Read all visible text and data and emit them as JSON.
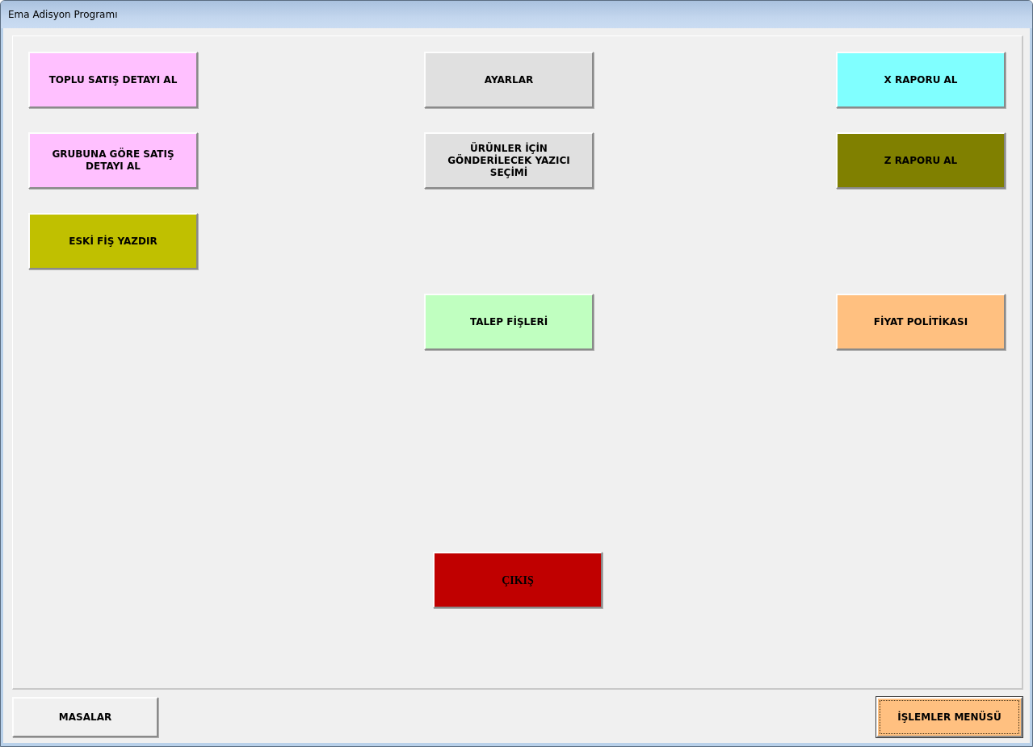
{
  "window": {
    "title": "Ema Adisyon Programı"
  },
  "panel": {
    "buttons": [
      {
        "label": "TOPLU SATIŞ DETAYI AL",
        "color": "#ffc0ff"
      },
      {
        "label": "AYARLAR",
        "color": "#e0e0e0"
      },
      {
        "label": "X RAPORU AL",
        "color": "#80ffff"
      },
      {
        "label": "GRUBUNA GÖRE SATIŞ DETAYI AL",
        "color": "#ffc0ff"
      },
      {
        "label": "ÜRÜNLER İÇİN GÖNDERİLECEK YAZICI SEÇİMİ",
        "color": "#e0e0e0"
      },
      {
        "label": "Z RAPORU AL",
        "color": "#808000"
      },
      {
        "label": "ESKİ FİŞ YAZDIR",
        "color": "#c0c000"
      },
      {
        "label": "TALEP FİŞLERİ",
        "color": "#c0ffc0"
      },
      {
        "label": "FİYAT POLİTİKASI",
        "color": "#ffc080"
      }
    ],
    "exit_button": {
      "label": "ÇIKIŞ",
      "color": "#c00000"
    }
  },
  "bottom_bar": [
    {
      "label": "MASALAR",
      "selected": false
    },
    {
      "label": "İŞLEMLER MENÜSÜ",
      "selected": true
    }
  ]
}
